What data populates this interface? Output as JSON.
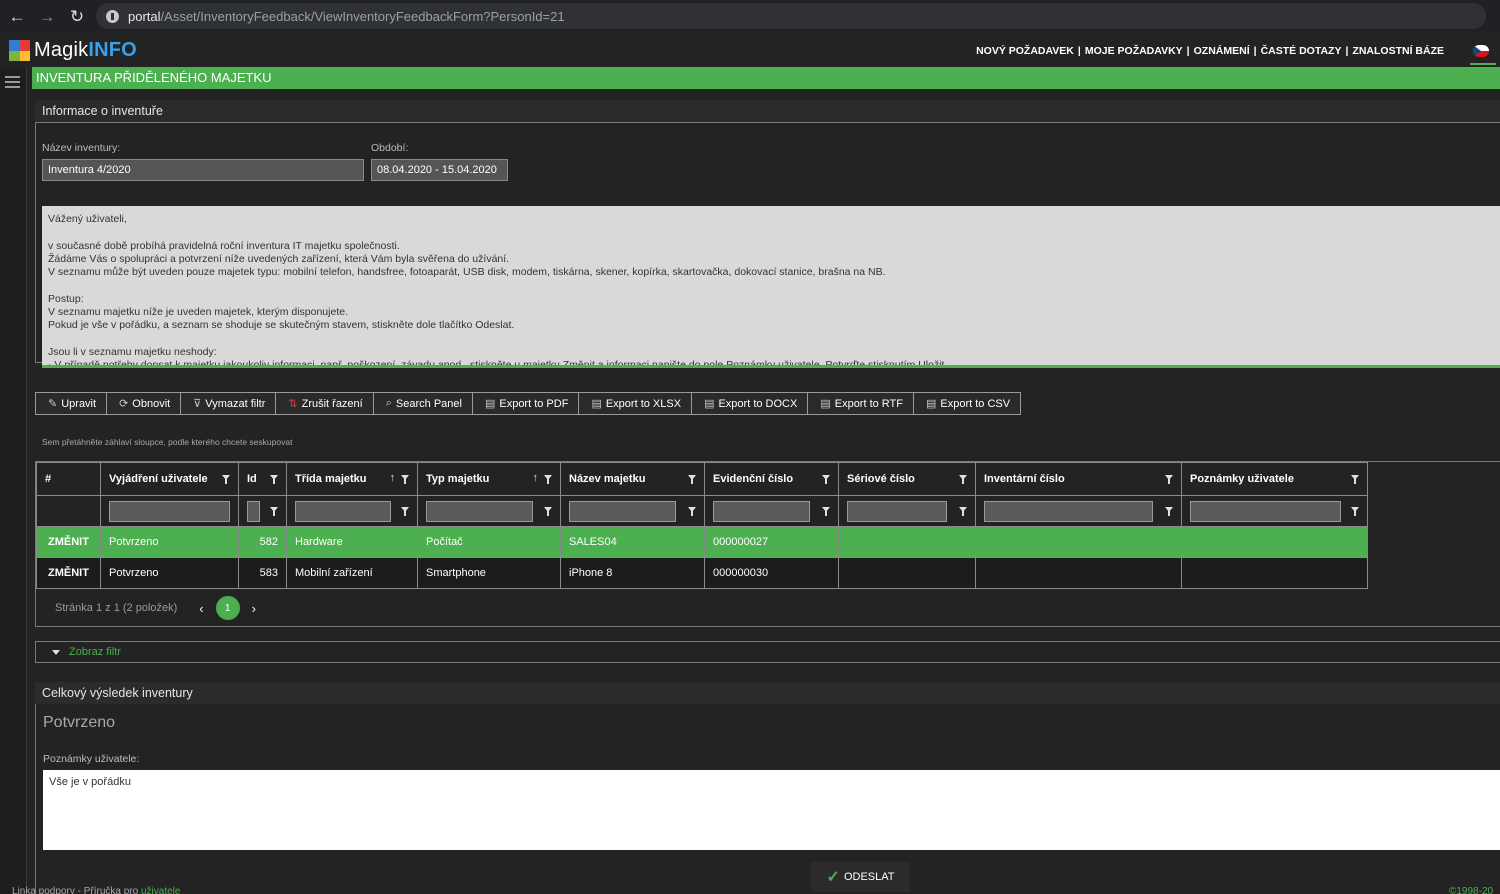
{
  "browser": {
    "url_domain": "portal",
    "url_path": "/Asset/InventoryFeedback/ViewInventoryFeedbackForm?PersonId=21"
  },
  "header": {
    "logo_part1": "Magik",
    "logo_part2": "INFO",
    "nav": [
      "NOVÝ POŽADAVEK",
      "MOJE POŽADAVKY",
      "OZNÁMENÍ",
      "ČASTÉ DOTAZY",
      "ZNALOSTNÍ BÁZE"
    ],
    "separator": "|",
    "colors": {
      "accent": "#4caf50",
      "logo_blue": "#3aa0e8"
    }
  },
  "page_title": "INVENTURA PŘIDĚLENÉHO MAJETKU",
  "info": {
    "heading": "Informace o inventuře",
    "name_label": "Název inventury:",
    "name_value": "Inventura 4/2020",
    "period_label": "Období:",
    "period_value": "08.04.2020 - 15.04.2020",
    "message": "Vážený uživateli,\n\nv současné době probíhá pravidelná roční inventura IT majetku společnosti.\nŽádáme Vás o spolupráci a potvrzení níže uvedených zařízení, která Vám byla svěřena do užívání.\nV seznamu může být uveden pouze majetek typu: mobilní telefon, handsfree, fotoaparát, USB disk, modem, tiskárna, skener, kopírka, skartovačka, dokovací stanice, brašna na NB.\n\nPostup:\nV seznamu majetku níže je uveden majetek, kterým disponujete.\nPokud je vše v pořádku, a seznam se shoduje se skutečným stavem, stiskněte dole tlačítko Odeslat.\n\nJsou li v seznamu majetku neshody:\n- V případě potřeby dopsat k majetku jakoukoliv informaci, např. poškození, závadu apod., stiskněte u majetku Změnit a informaci napište do pole Poznámky uživatele. Potvrďte stisknutím Uložit."
  },
  "toolbar": {
    "edit": "Upravit",
    "refresh": "Obnovit",
    "clear_filter": "Vymazat filtr",
    "clear_sort": "Zrušit řazení",
    "search_panel": "Search Panel",
    "pdf": "Export to PDF",
    "xlsx": "Export to XLSX",
    "docx": "Export to DOCX",
    "rtf": "Export to RTF",
    "csv": "Export to CSV"
  },
  "group_hint": "Sem přetáhněte záhlaví sloupce, podle kterého chcete seskupovat",
  "grid": {
    "columns": [
      "#",
      "Vyjádření uživatele",
      "Id",
      "Třída majetku",
      "Typ majetku",
      "Název majetku",
      "Evidenční číslo",
      "Sériové číslo",
      "Inventární číslo",
      "Poznámky uživatele"
    ],
    "rows": [
      {
        "action": "ZMĚNIT",
        "statement": "Potvrzeno",
        "id": "582",
        "class": "Hardware",
        "type": "Počítač",
        "name": "SALES04",
        "evid": "000000027",
        "serial": "",
        "inv": "",
        "notes": ""
      },
      {
        "action": "ZMĚNIT",
        "statement": "Potvrzeno",
        "id": "583",
        "class": "Mobilní zařízení",
        "type": "Smartphone",
        "name": "iPhone 8",
        "evid": "000000030",
        "serial": "",
        "inv": "",
        "notes": ""
      }
    ],
    "pager_text": "Stránka 1 z 1 (2 položek)",
    "current_page": "1",
    "sort_arrow": "↑",
    "prev_arrow": "‹",
    "next_arrow": "›"
  },
  "filter_toggle": "Zobraz filtr",
  "result": {
    "heading": "Celkový výsledek inventury",
    "value": "Potvrzeno",
    "notes_label": "Poznámky uživatele:",
    "notes_value": "Vše je v pořádku"
  },
  "send_button": "ODESLAT",
  "footer": {
    "part1": "Linka podpory",
    "dash": "-",
    "part2": "Příručka pro",
    "link": "uživatele",
    "copyright": "©1998-20"
  }
}
